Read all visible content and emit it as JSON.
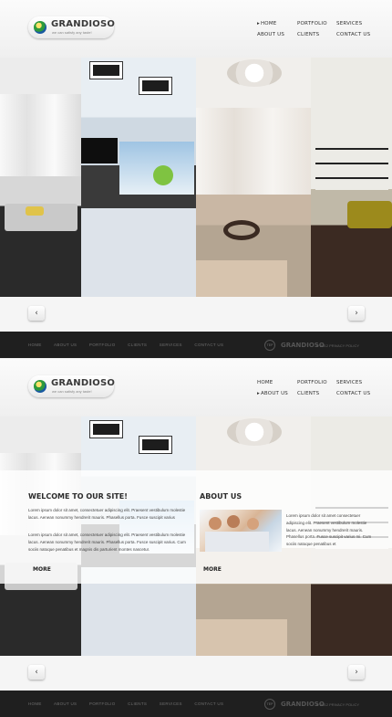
{
  "site": {
    "logo_text": "GRANDIOSO",
    "logo_tagline": "we can satisfy any taste!",
    "nav": [
      "HOME",
      "PORTFOLIO",
      "SERVICES",
      "ABOUT US",
      "CLIENTS",
      "CONTACT US"
    ],
    "footer_links": [
      "HOME",
      "ABOUT US",
      "PORTFOLIO",
      "CLIENTS",
      "SERVICES",
      "CONTACT US"
    ],
    "footer_badge": "TEP",
    "footer_brand": "GRANDIOSO",
    "footer_copyright": "© 2012 PRIVACY POLICY"
  },
  "screens": [
    {
      "active_nav": "HOME"
    },
    {
      "active_nav": "ABOUT US"
    }
  ],
  "welcome": {
    "title": "WELCOME TO OUR SITE!",
    "para1": "Lorem ipsum dolor sit amet, consectetuer adipiscing elit. Praesent vestibulum molestie lacus. Aenean nonummy hendrerit mauris. Phasellus porta. Fusce suscipit varius",
    "para2": "Lorem ipsum dolor sit amet, consectetuer adipiscing elit. Praesent vestibulum molestie lacus. Aenean nonummy hendrerit mauris. Phasellus porta. Fusce suscipit varius. Cum sociis natoque penatibus et magnis dis parturient montes nascetur.",
    "more": "MORE"
  },
  "about": {
    "title": "ABOUT US",
    "text": "Lorem ipsum dolor sit amet consectetuer adipiscing elit. Praesent vestibulum molestie lacus. Aenean nonummy hendrerit mauris. Phasellus porta. Fusce suscipit varius mi. Cum sociis natoque penatibus et",
    "more": "MORE"
  },
  "carousel": {
    "prev": "‹",
    "next": "›"
  },
  "colors": {
    "footer_bg": "#1f1f1f",
    "header_bg": "#f7f7f7"
  }
}
